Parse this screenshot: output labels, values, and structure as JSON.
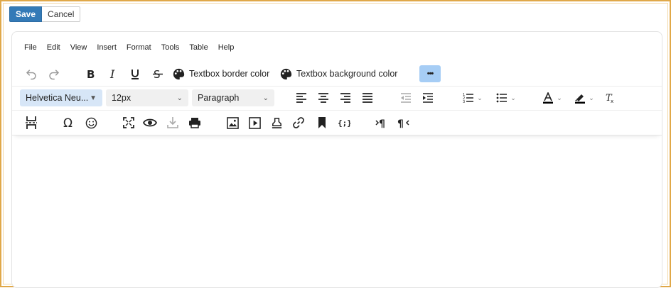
{
  "actions": {
    "save_label": "Save",
    "cancel_label": "Cancel"
  },
  "menubar": {
    "items": [
      "File",
      "Edit",
      "View",
      "Insert",
      "Format",
      "Tools",
      "Table",
      "Help"
    ]
  },
  "toolbar1": {
    "border_color_label": "Textbox border color",
    "background_color_label": "Textbox background color",
    "more_label": "•••"
  },
  "toolbar2": {
    "font_family": "Helvetica Neu...",
    "font_size": "12px",
    "block_format": "Paragraph"
  },
  "colors": {
    "accent": "#337ab7",
    "frame": "#e0a848",
    "more_bg": "#a6cdf5",
    "font_select_bg": "#d7e6f7"
  }
}
